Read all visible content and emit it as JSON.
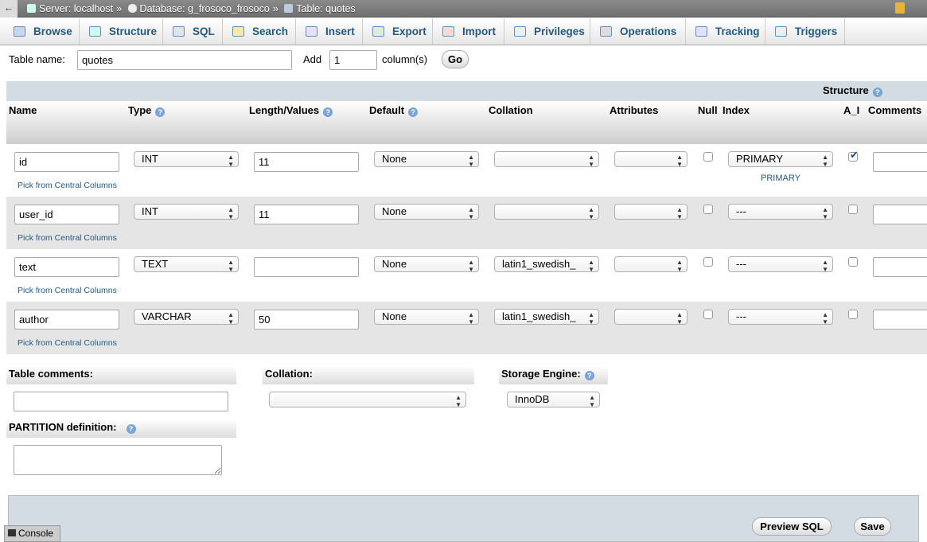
{
  "breadcrumb": {
    "back": "←",
    "server": "Server: localhost",
    "database": "Database: g_frosoco_frosoco",
    "table": "Table: quotes",
    "sep": "»"
  },
  "tabs": [
    "Browse",
    "Structure",
    "SQL",
    "Search",
    "Insert",
    "Export",
    "Import",
    "Privileges",
    "Operations",
    "Tracking",
    "Triggers"
  ],
  "form": {
    "table_name_label": "Table name:",
    "table_name": "quotes",
    "add_label": "Add",
    "add_count": "1",
    "columns_label": "column(s)",
    "go": "Go"
  },
  "structure_label": "Structure",
  "headers": [
    "Name",
    "Type",
    "Length/Values",
    "Default",
    "Collation",
    "Attributes",
    "Null",
    "Index",
    "A_I",
    "Comments"
  ],
  "pick_label": "Pick from Central Columns",
  "rows": [
    {
      "name": "id",
      "type": "INT",
      "length": "11",
      "default": "None",
      "collation": "",
      "attributes": "",
      "null": false,
      "index": "PRIMARY",
      "index_note": "PRIMARY",
      "ai": true,
      "comments": ""
    },
    {
      "name": "user_id",
      "type": "INT",
      "length": "11",
      "default": "None",
      "collation": "",
      "attributes": "",
      "null": false,
      "index": "---",
      "index_note": "",
      "ai": false,
      "comments": ""
    },
    {
      "name": "text",
      "type": "TEXT",
      "length": "",
      "default": "None",
      "collation": "latin1_swedish_",
      "attributes": "",
      "null": false,
      "index": "---",
      "index_note": "",
      "ai": false,
      "comments": ""
    },
    {
      "name": "author",
      "type": "VARCHAR",
      "length": "50",
      "default": "None",
      "collation": "latin1_swedish_",
      "attributes": "",
      "null": false,
      "index": "---",
      "index_note": "",
      "ai": false,
      "comments": ""
    }
  ],
  "bottom": {
    "table_comments_label": "Table comments:",
    "table_comments": "",
    "collation_label": "Collation:",
    "collation": "",
    "engine_label": "Storage Engine:",
    "engine": "InnoDB",
    "partition_label": "PARTITION definition:",
    "partition": ""
  },
  "footer": {
    "preview": "Preview SQL",
    "save": "Save",
    "console": "Console"
  }
}
